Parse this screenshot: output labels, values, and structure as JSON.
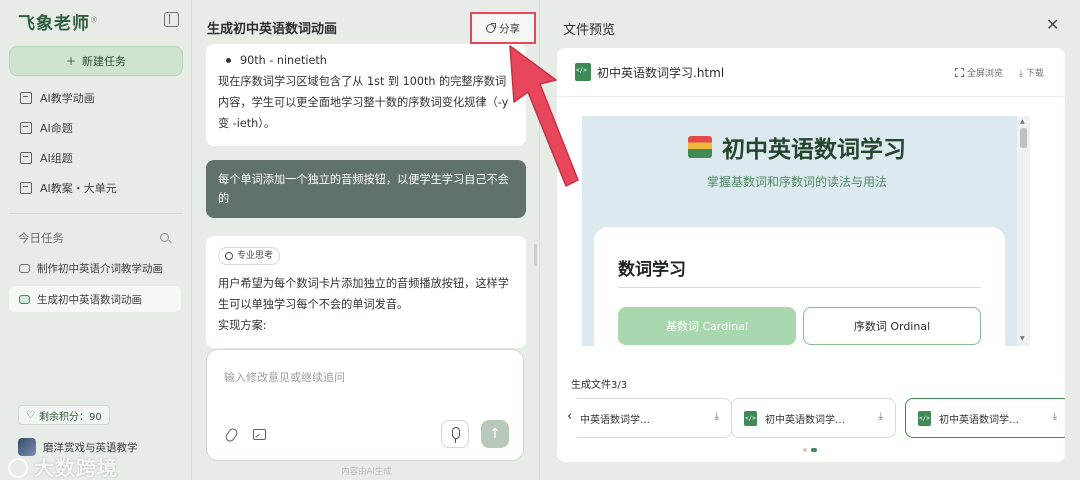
{
  "sidebar": {
    "brand": "飞象老师",
    "brand_mark": "®",
    "new_task": "新建任务",
    "nav": [
      {
        "label": "AI教学动画",
        "icon": "animation-icon"
      },
      {
        "label": "AI命题",
        "icon": "question-icon"
      },
      {
        "label": "AI组题",
        "icon": "compose-icon"
      },
      {
        "label": "AI教案・大单元",
        "icon": "lesson-plan-icon"
      }
    ],
    "today_label": "今日任务",
    "tasks": [
      {
        "label": "制作初中英语介词教学动画",
        "active": false
      },
      {
        "label": "生成初中英语数词动画",
        "active": true
      }
    ],
    "points": "剩余积分：90",
    "user_name": "磨洋赏戏与英语教学"
  },
  "watermark": "大数跨境",
  "chat": {
    "title": "生成初中英语数词动画",
    "share_label": "分享",
    "card1": {
      "bullet": "90th - ninetieth",
      "text": "现在序数词学习区域包含了从 1st 到 100th 的完整序数词内容，学生可以更全面地学习整十数的序数词变化规律（-y 变 -ieth）。"
    },
    "user_message": "每个单词添加一个独立的音频按钮，以便学生学习自己不会的",
    "card2": {
      "tag": "专业思考",
      "line1": "用户希望为每个数词卡片添加独立的音频播放按钮，这样学生可以单独学习每个不会的单词发音。",
      "line2": "实现方案:"
    },
    "input_placeholder": "输入修改意见或继续追问",
    "footnote": "内容由AI生成"
  },
  "preview": {
    "title": "文件预览",
    "file_name": "初中英语数词学习.html",
    "fullscreen": "全屏浏览",
    "download": "下载",
    "page": {
      "title": "初中英语数词学习",
      "subtitle": "掌握基数词和序数词的读法与用法",
      "section_title": "数词学习",
      "tab_cardinal": "基数词 Cardinal",
      "tab_ordinal": "序数词 Ordinal"
    },
    "generated_label": "生成文件3/3",
    "files": [
      {
        "name": "中英语数词学…"
      },
      {
        "name": "初中英语数词学…"
      },
      {
        "name": "初中英语数词学…"
      }
    ],
    "page_indicator": {
      "pages": 2,
      "current": 2
    }
  },
  "colors": {
    "accent": "#3f8a56",
    "user_bubble": "#617368",
    "highlight": "#e8465b"
  }
}
